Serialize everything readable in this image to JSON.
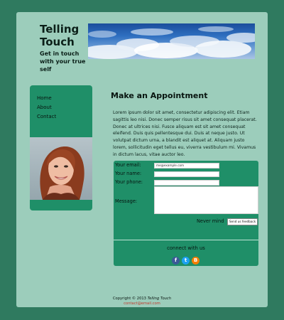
{
  "brand": {
    "title": "Telling Touch",
    "tagline": "Get in touch with your true self"
  },
  "nav": {
    "items": [
      {
        "label": "Home"
      },
      {
        "label": "About"
      },
      {
        "label": "Contact"
      }
    ]
  },
  "main": {
    "title": "Make an Appointment",
    "intro": "Lorem ipsum dolor sit amet, consectetur adipiscing elit. Etiam sagittis leo nisi. Donec semper risus sit amet consequat placerat. Donec at ultrices nisi. Fusce aliquam est sit amet consequat eleifend. Duis quis pellentesque dui. Duis at neque justo. Ut volutpat dictum urna, a blandit est aliquet at. Aliquam justo lorem, sollicitudin eget tellus eu, viverra vestibulum mi. Vivamus in dictum lacus, vitae auctor leo."
  },
  "form": {
    "email_label": "Your email:",
    "email_value": "me@example.com",
    "name_label": "Your name:",
    "phone_label": "Your phone:",
    "message_label": "Message:",
    "never_mind": "Never mind",
    "send_label": "Send us feedback",
    "connect_label": "connect with us"
  },
  "social": [
    {
      "icon": "facebook-icon",
      "glyph": "f",
      "color": "#3b5998"
    },
    {
      "icon": "twitter-icon",
      "glyph": "t",
      "color": "#1da1f2"
    },
    {
      "icon": "blogger-icon",
      "glyph": "B",
      "color": "#f57d00"
    }
  ],
  "footer": {
    "copyright_prefix": "Copyright © 2013",
    "site_name": "Telling Touch",
    "email": "contact@email.com"
  },
  "colors": {
    "background": "#2f7a5f",
    "page": "#9ccdbb",
    "panel": "#1f8f68",
    "link": "#c0392b"
  }
}
